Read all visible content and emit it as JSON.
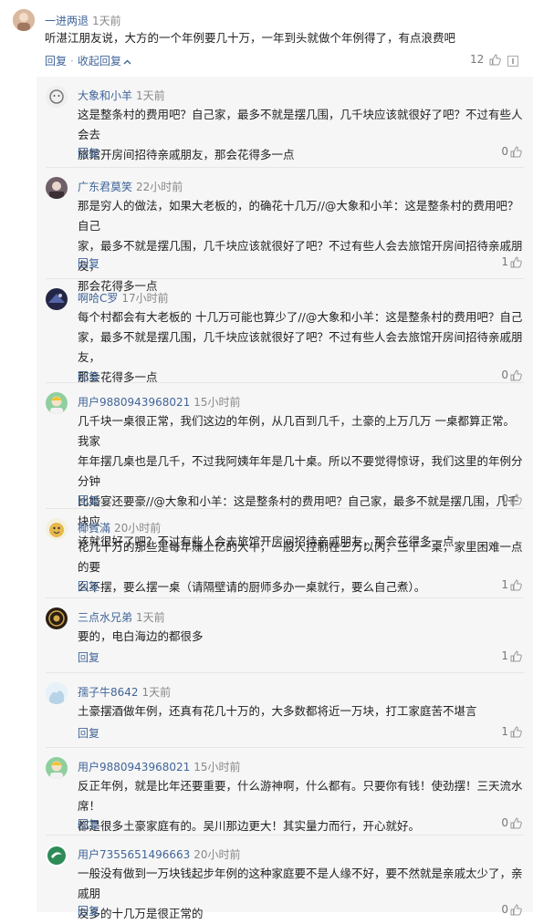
{
  "top_comment": {
    "user": "一进两退",
    "time": "1天前",
    "text": "听湛江朋友说，大方的一个年例要几十万，一年到头就做个年例得了，有点浪费吧",
    "reply_label": "回复",
    "collapse_label": "收起回复",
    "likes": "12",
    "avatar_color": "#c8a68e"
  },
  "replies": [
    {
      "user": "大象和小羊",
      "time": "1天前",
      "lines": [
        "这是整条村的费用吧？自己家，最多不就是摆几围，几千块应该就很好了吧？不过有些人会去",
        "旅馆开房间招待亲戚朋友，那会花得多一点"
      ],
      "reply_label": "回复",
      "likes": "0",
      "avatar_color": "#dddddd"
    },
    {
      "user": "广东君莫笑",
      "time": "22小时前",
      "lines": [
        "那是穷人的做法，如果大老板的，的确花十几万//@大象和小羊：这是整条村的费用吧？自己",
        "家，最多不就是摆几围，几千块应该就很好了吧？不过有些人会去旅馆开房间招待亲戚朋友，",
        "那会花得多一点"
      ],
      "reply_label": "回复",
      "likes": "1",
      "avatar_color": "#7a6a72"
    },
    {
      "user": "啊哈C罗",
      "time": "17小时前",
      "lines": [
        "每个村都会有大老板的 十几万可能也算少了//@大象和小羊：这是整条村的费用吧？自己",
        "家，最多不就是摆几围，几千块应该就很好了吧？不过有些人会去旅馆开房间招待亲戚朋友，",
        "那会花得多一点"
      ],
      "reply_label": "回复",
      "likes": "0",
      "avatar_color": "#2b2f55"
    },
    {
      "user": "用户9880943968021",
      "time": "15小时前",
      "lines": [
        "几千块一桌很正常，我们这边的年例，从几百到几千，土豪的上万几万 一桌都算正常。我家",
        "年年摆几桌也是几千，不过我阿姨年年是几十桌。所以不要觉得惊讶，我们这里的年例分分钟",
        "比婚宴还要豪//@大象和小羊：这是整条村的费用吧？自己家，最多不就是摆几围，几千块应",
        "该就很好了吧？不过有些人会去旅馆开房间招待亲戚朋友，那会花得多一点"
      ],
      "reply_label": "回复",
      "likes": "0",
      "avatar_color": "#8fcf9f"
    },
    {
      "user": "椰賓滿",
      "time": "20小时前",
      "lines": [
        "花几十万的那些是每年赚上亿的大牛，一般人控制在三万以内，三千一桌，家里困难一点的要",
        "么不摆，要么摆一桌（请隔壁请的厨师多办一桌就行，要么自己煮）。"
      ],
      "reply_label": "回复",
      "likes": "1",
      "avatar_color": "#e6b84a"
    },
    {
      "user": "三点水兄弟",
      "time": "1天前",
      "lines": [
        "要的，电白海边的都很多"
      ],
      "reply_label": "回复",
      "likes": "1",
      "avatar_color": "#3a2a1a"
    },
    {
      "user": "孺子牛8642",
      "time": "1天前",
      "lines": [
        "土豪摆酒做年例，还真有花几十万的，大多数都将近一万块，打工家庭苦不堪言"
      ],
      "reply_label": "回复",
      "likes": "1",
      "avatar_color": "#cfe3f2"
    },
    {
      "user": "用户9880943968021",
      "time": "15小时前",
      "lines": [
        "反正年例，就是比年还要重要，什么游神啊，什么都有。只要你有钱！使劲摆！三天流水席！",
        "都是很多土豪家庭有的。吴川那边更大！其实量力而行，开心就好。"
      ],
      "reply_label": "回复",
      "likes": "0",
      "avatar_color": "#8fcf9f"
    },
    {
      "user": "用户7355651496663",
      "time": "20小时前",
      "lines": [
        "一般没有做到一万块钱起步年例的这种家庭要不是人缘不好，要不然就是亲戚太少了，亲戚朋",
        "友多的十几万是很正常的"
      ],
      "reply_label": "回复",
      "likes": "0",
      "avatar_color": "#2e8b57"
    }
  ]
}
